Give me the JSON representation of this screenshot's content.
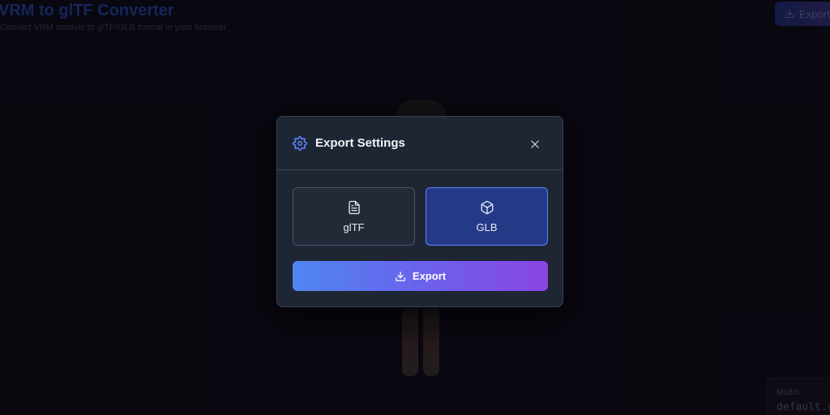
{
  "header": {
    "title": "VRM to glTF Converter",
    "subtitle": "Convert VRM models to glTF/GLB format in your browser",
    "export_label": "Export"
  },
  "model_panel": {
    "label": "Model:",
    "value": "default.vrm"
  },
  "modal": {
    "title": "Export Settings",
    "formats": [
      {
        "label": "glTF",
        "icon": "file-text-icon",
        "selected": false
      },
      {
        "label": "GLB",
        "icon": "cube-icon",
        "selected": true
      }
    ],
    "export_label": "Export"
  },
  "colors": {
    "accent": "#5a86ff",
    "selected_bg": "#253a87",
    "gradient_start": "#4f86f2",
    "gradient_end": "#8a45e2",
    "modal_bg": "#1f2633"
  }
}
